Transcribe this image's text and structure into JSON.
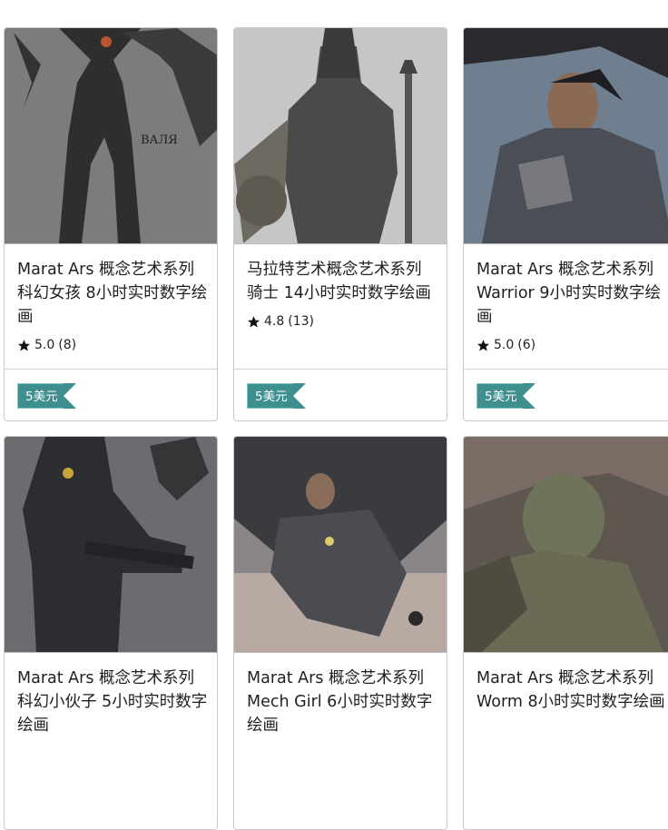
{
  "cards": [
    {
      "title": "Marat Ars 概念艺术系列 科幻女孩 8小时实时数字绘画",
      "rating": "5.0",
      "count": "(8)",
      "price": "5美元",
      "image_text": "ВАЛЯ"
    },
    {
      "title": "马拉特艺术概念艺术系列 骑士 14小时实时数字绘画",
      "rating": "4.8",
      "count": "(13)",
      "price": "5美元"
    },
    {
      "title": "Marat Ars 概念艺术系列 Warrior 9小时实时数字绘画",
      "rating": "5.0",
      "count": "(6)",
      "price": "5美元"
    },
    {
      "title": "Marat Ars 概念艺术系列 科幻小伙子 5小时实时数字绘画"
    },
    {
      "title": "Marat Ars 概念艺术系列 Mech Girl 6小时实时数字绘画"
    },
    {
      "title": "Marat Ars 概念艺术系列 Worm 8小时实时数字绘画"
    }
  ],
  "colors": {
    "price_tag": "#3f8f8f",
    "card_border": "#c9c9c9"
  },
  "icons": {
    "rating": "star-icon"
  }
}
